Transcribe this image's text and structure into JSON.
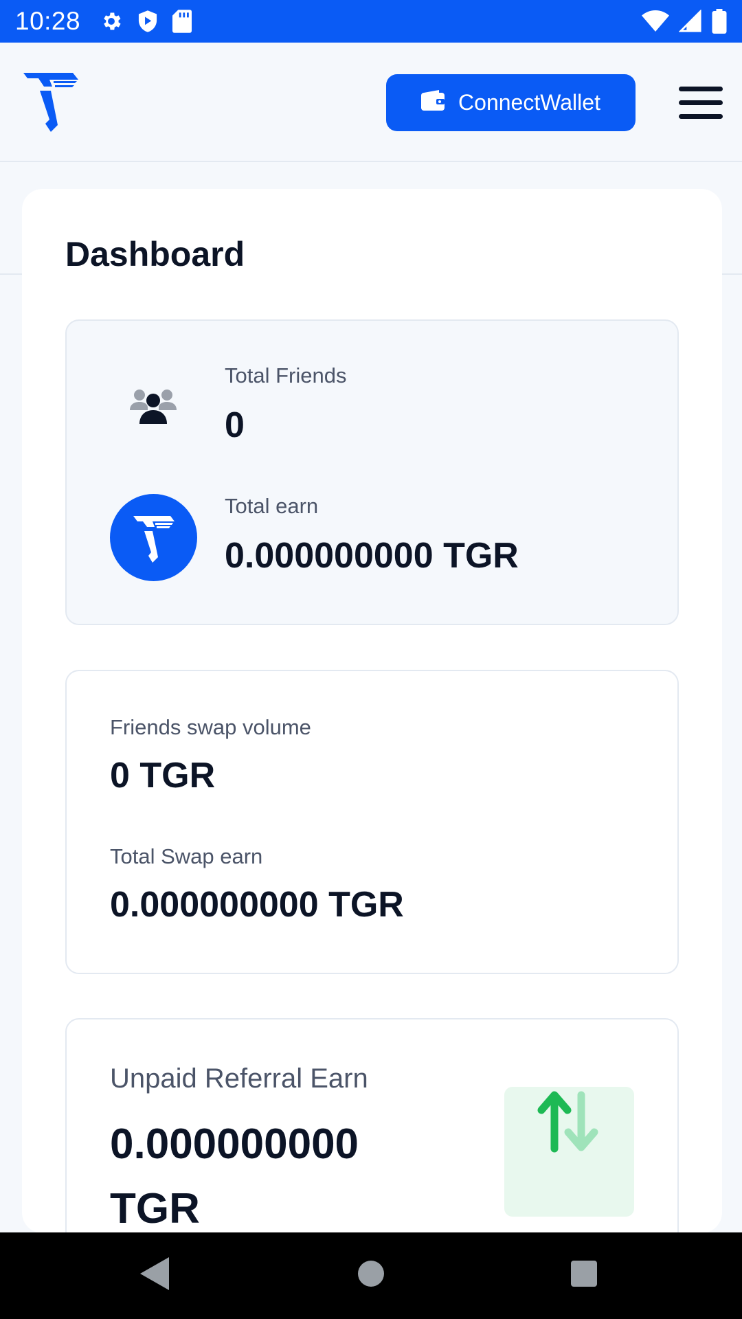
{
  "status_bar": {
    "time": "10:28",
    "left_icons": [
      "gear-icon",
      "shield-icon",
      "sd-card-icon"
    ],
    "right_icons": [
      "wifi-icon",
      "signal-icon",
      "battery-icon"
    ]
  },
  "header": {
    "logo": "tiger-logo",
    "connect_label": "ConnectWallet",
    "connect_icon": "wallet-icon",
    "menu_icon": "hamburger-menu-icon"
  },
  "dashboard": {
    "title": "Dashboard",
    "summary": {
      "friends_label": "Total Friends",
      "friends_value": "0",
      "earn_label": "Total earn",
      "earn_value": "0.000000000 TGR"
    },
    "swap": {
      "volume_label": "Friends swap volume",
      "volume_value": "0 TGR",
      "earn_label": "Total Swap earn",
      "earn_value": "0.000000000 TGR"
    },
    "referral": {
      "label": "Unpaid Referral Earn",
      "value_line1": "0.000000000",
      "value_line2": "TGR",
      "icon": "swap-arrows-icon"
    }
  },
  "colors": {
    "accent": "#0a5bf5",
    "text": "#0c1426",
    "muted": "#4b5468",
    "border": "#e3e9f1",
    "green": "#1db954"
  }
}
